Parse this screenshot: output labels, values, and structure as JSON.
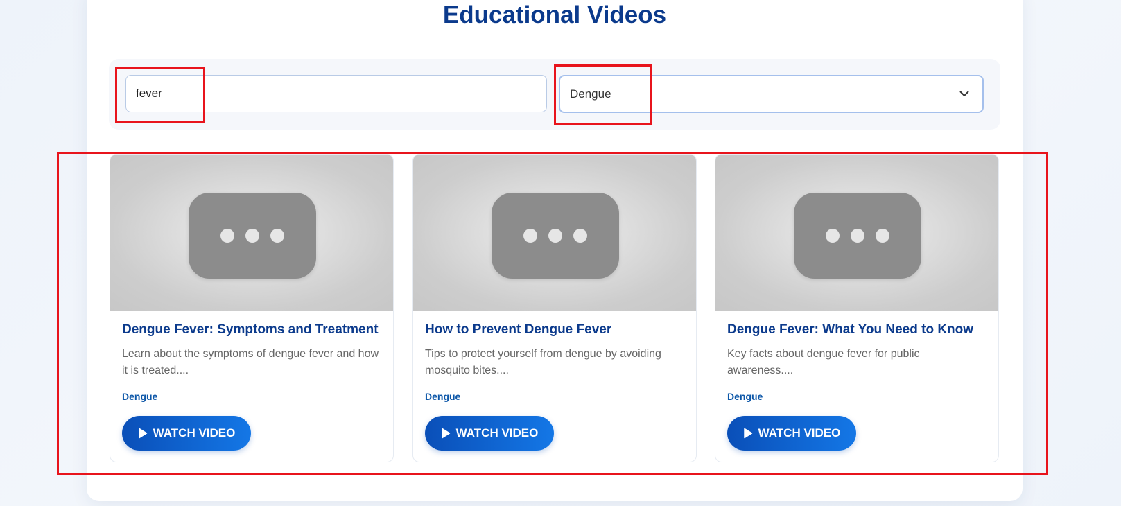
{
  "page": {
    "title": "Educational Videos"
  },
  "filters": {
    "search_value": "fever",
    "category_selected": "Dengue"
  },
  "videos": [
    {
      "title": "Dengue Fever: Symptoms and Treatment",
      "description": "Learn about the symptoms of dengue fever and how it is treated....",
      "tag": "Dengue",
      "button_label": "WATCH VIDEO"
    },
    {
      "title": "How to Prevent Dengue Fever",
      "description": "Tips to protect yourself from dengue by avoiding mosquito bites....",
      "tag": "Dengue",
      "button_label": "WATCH VIDEO"
    },
    {
      "title": "Dengue Fever: What You Need to Know",
      "description": "Key facts about dengue fever for public awareness....",
      "tag": "Dengue",
      "button_label": "WATCH VIDEO"
    }
  ],
  "icons": {
    "select_chevron": "chevron-down-icon",
    "thumbnail": "video-placeholder-icon",
    "play": "play-icon"
  },
  "colors": {
    "accent": "#0b3a8c",
    "button": "#0a4fb8",
    "tag": "#0d57a8",
    "highlight": "#e8141c"
  }
}
